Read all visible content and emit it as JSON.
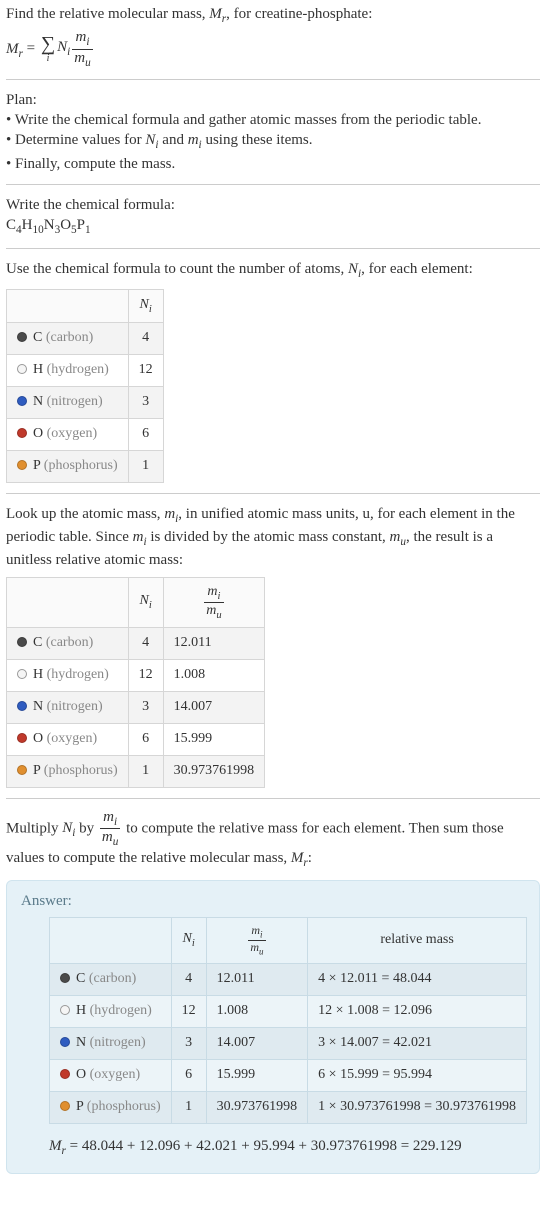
{
  "intro": {
    "line1": "Find the relative molecular mass, ",
    "mr": "M",
    "mr_sub": "r",
    "line1b": ", for creatine-phosphate:",
    "eq_lhs": "M",
    "eq_lhs_sub": "r",
    "eq_eq": " = ",
    "sigma_lim": "i",
    "Ni": "N",
    "Ni_sub": "i",
    "frac_num_m": "m",
    "frac_num_sub": "i",
    "frac_den_m": "m",
    "frac_den_sub": "u"
  },
  "plan": {
    "title": "Plan:",
    "b1": "• Write the chemical formula and gather atomic masses from the periodic table.",
    "b2_a": "• Determine values for ",
    "b2_b": " and ",
    "b2_c": " using these items.",
    "b3": "• Finally, compute the mass."
  },
  "write": {
    "title": "Write the chemical formula:",
    "formula_parts": [
      "C",
      "4",
      "H",
      "10",
      "N",
      "3",
      "O",
      "5",
      "P",
      "1"
    ]
  },
  "count": {
    "line_a": "Use the chemical formula to count the number of atoms, ",
    "line_b": ", for each element:",
    "header_Ni": "N",
    "header_Ni_sub": "i",
    "rows": [
      {
        "dot": "bullet-C",
        "sym": "C",
        "name": "(carbon)",
        "n": "4"
      },
      {
        "dot": "bullet-H",
        "sym": "H",
        "name": "(hydrogen)",
        "n": "12"
      },
      {
        "dot": "bullet-N",
        "sym": "N",
        "name": "(nitrogen)",
        "n": "3"
      },
      {
        "dot": "bullet-O",
        "sym": "O",
        "name": "(oxygen)",
        "n": "6"
      },
      {
        "dot": "bullet-P",
        "sym": "P",
        "name": "(phosphorus)",
        "n": "1"
      }
    ]
  },
  "lookup": {
    "p1_a": "Look up the atomic mass, ",
    "p1_b": ", in unified atomic mass units, u, for each element in the periodic table. Since ",
    "p1_c": " is divided by the atomic mass constant, ",
    "p1_d": ", the result is a unitless relative atomic mass:",
    "rows": [
      {
        "dot": "bullet-C",
        "sym": "C",
        "name": "(carbon)",
        "n": "4",
        "m": "12.011"
      },
      {
        "dot": "bullet-H",
        "sym": "H",
        "name": "(hydrogen)",
        "n": "12",
        "m": "1.008"
      },
      {
        "dot": "bullet-N",
        "sym": "N",
        "name": "(nitrogen)",
        "n": "3",
        "m": "14.007"
      },
      {
        "dot": "bullet-O",
        "sym": "O",
        "name": "(oxygen)",
        "n": "6",
        "m": "15.999"
      },
      {
        "dot": "bullet-P",
        "sym": "P",
        "name": "(phosphorus)",
        "n": "1",
        "m": "30.973761998"
      }
    ]
  },
  "multiply": {
    "p_a": "Multiply ",
    "p_b": " by ",
    "p_c": " to compute the relative mass for each element. Then sum those values to compute the relative molecular mass, ",
    "p_d": ":"
  },
  "answer": {
    "label": "Answer:",
    "header_rel": "relative mass",
    "rows": [
      {
        "dot": "bullet-C",
        "sym": "C",
        "name": "(carbon)",
        "n": "4",
        "m": "12.011",
        "calc": "4 × 12.011 = 48.044"
      },
      {
        "dot": "bullet-H",
        "sym": "H",
        "name": "(hydrogen)",
        "n": "12",
        "m": "1.008",
        "calc": "12 × 1.008 = 12.096"
      },
      {
        "dot": "bullet-N",
        "sym": "N",
        "name": "(nitrogen)",
        "n": "3",
        "m": "14.007",
        "calc": "3 × 14.007 = 42.021"
      },
      {
        "dot": "bullet-O",
        "sym": "O",
        "name": "(oxygen)",
        "n": "6",
        "m": "15.999",
        "calc": "6 × 15.999 = 95.994"
      },
      {
        "dot": "bullet-P",
        "sym": "P",
        "name": "(phosphorus)",
        "n": "1",
        "m": "30.973761998",
        "calc": "1 × 30.973761998 = 30.973761998"
      }
    ],
    "final_eq": " = 48.044 + 12.096 + 42.021 + 95.994 + 30.973761998 = 229.129"
  }
}
